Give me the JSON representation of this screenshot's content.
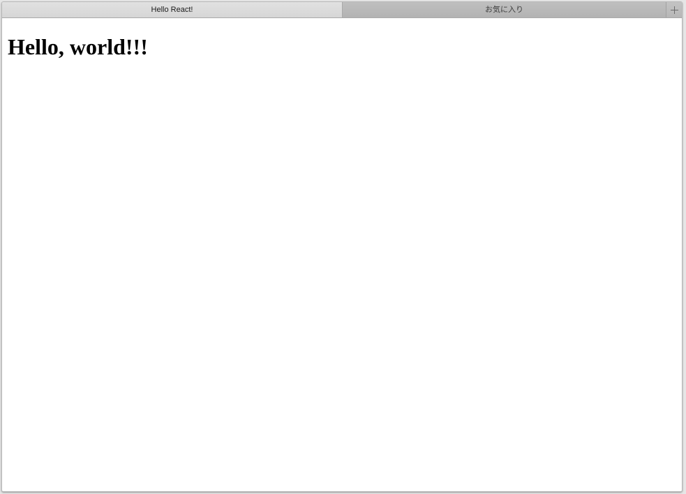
{
  "tabs": [
    {
      "label": "Hello React!",
      "active": true
    },
    {
      "label": "お気に入り",
      "active": false
    }
  ],
  "new_tab": {
    "icon": "plus-icon"
  },
  "page": {
    "heading": "Hello, world!!!"
  }
}
